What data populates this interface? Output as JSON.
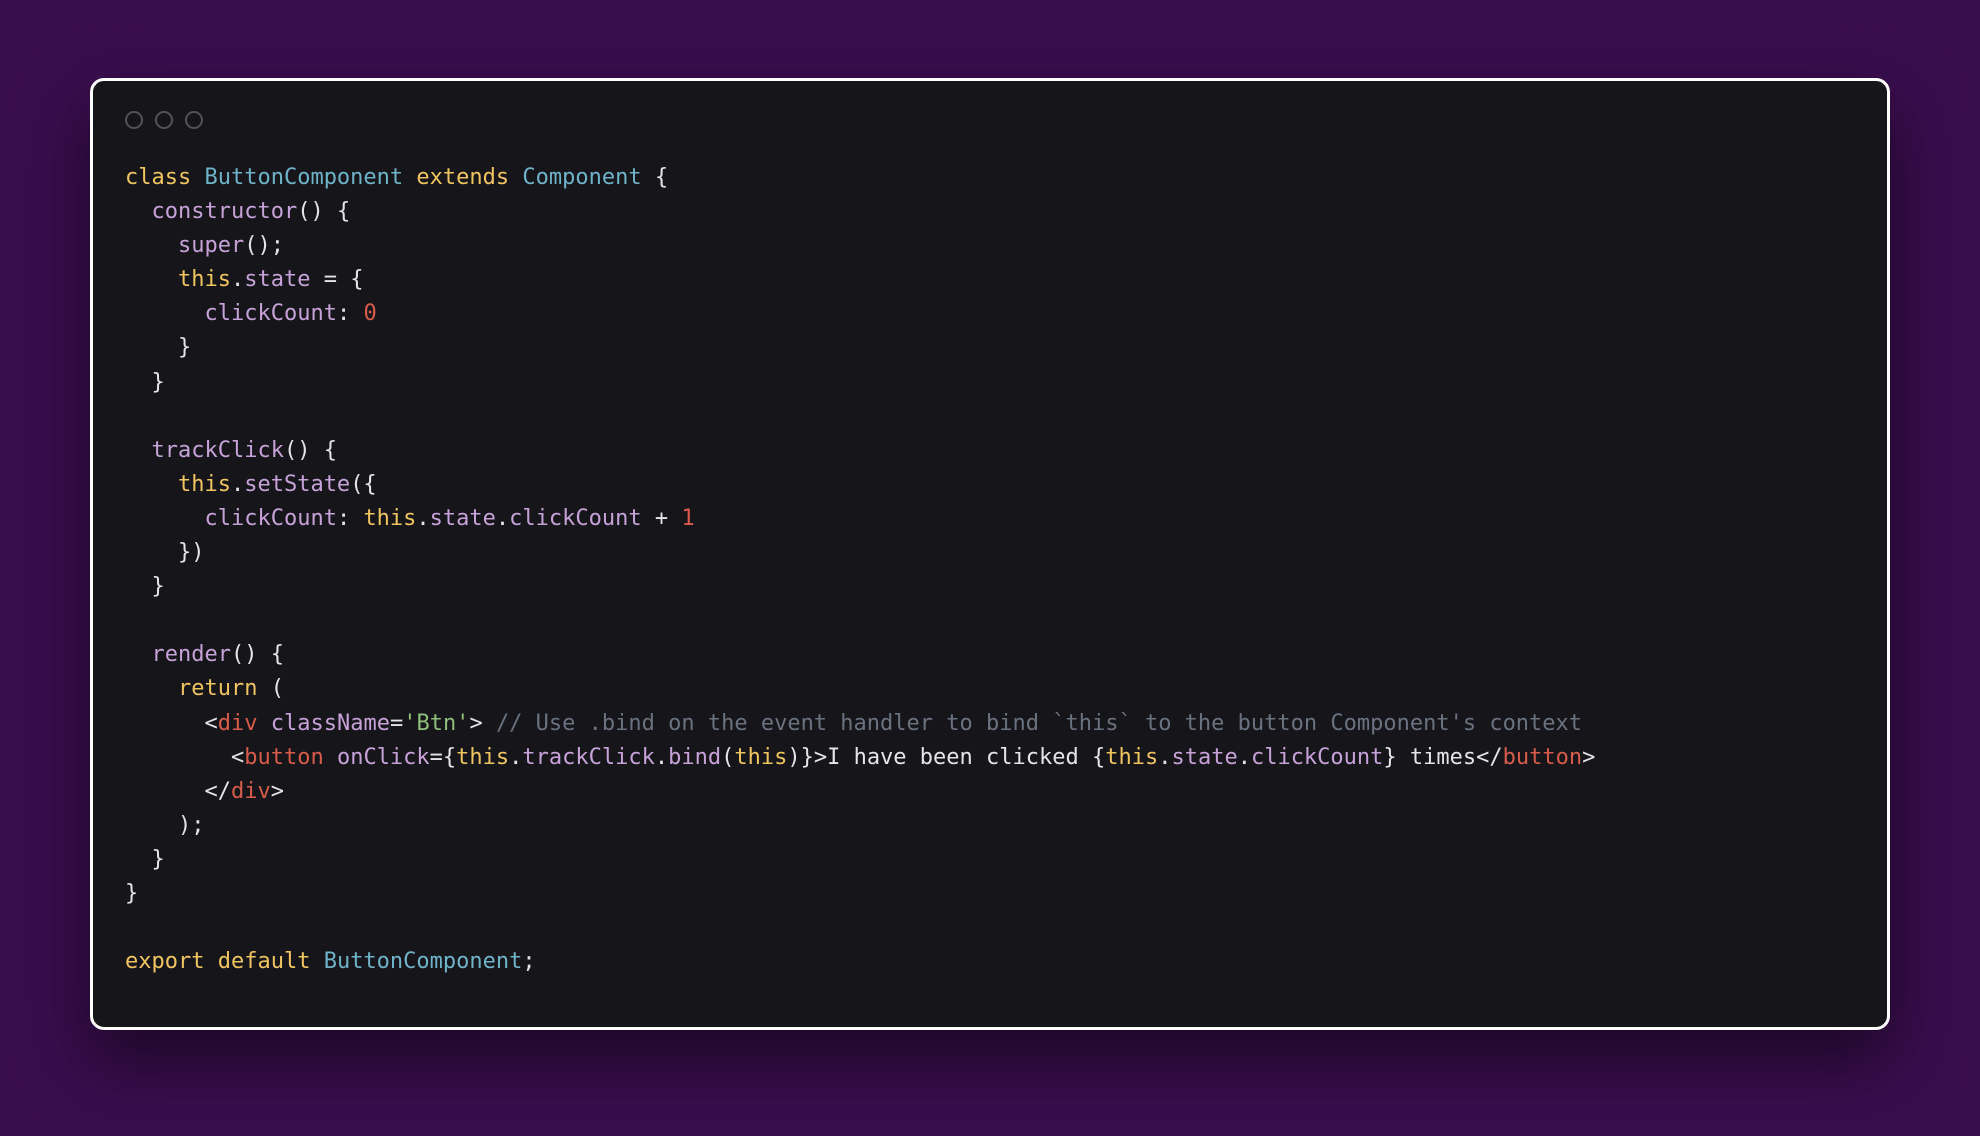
{
  "code": {
    "l1": {
      "kw1": "class",
      "type1": "ButtonComponent",
      "kw2": "extends",
      "type2": "Component",
      "brace": " {"
    },
    "l2": {
      "indent": "  ",
      "fn": "constructor",
      "rest": "() {"
    },
    "l3": {
      "indent": "    ",
      "fn": "super",
      "rest": "();"
    },
    "l4": {
      "indent": "    ",
      "this": "this",
      "dot": ".",
      "prop": "state",
      "rest": " = {"
    },
    "l5": {
      "indent": "      ",
      "prop": "clickCount",
      "colon": ": ",
      "num": "0"
    },
    "l6": {
      "indent": "    ",
      "brace": "}"
    },
    "l7": {
      "indent": "  ",
      "brace": "}"
    },
    "l9": {
      "indent": "  ",
      "fn": "trackClick",
      "rest": "() {"
    },
    "l10": {
      "indent": "    ",
      "this": "this",
      "dot": ".",
      "fn": "setState",
      "rest": "({"
    },
    "l11": {
      "indent": "      ",
      "prop": "clickCount",
      "colon": ": ",
      "this": "this",
      "dot1": ".",
      "state": "state",
      "dot2": ".",
      "cc": "clickCount",
      "plus": " + ",
      "num": "1"
    },
    "l12": {
      "indent": "    ",
      "brace": "})"
    },
    "l13": {
      "indent": "  ",
      "brace": "}"
    },
    "l15": {
      "indent": "  ",
      "fn": "render",
      "rest": "() {"
    },
    "l16": {
      "indent": "    ",
      "kw": "return",
      "rest": " ("
    },
    "l17": {
      "indent": "      ",
      "open": "<",
      "tag": "div",
      "sp": " ",
      "attr": "className",
      "eq": "=",
      "str": "'Btn'",
      "close": ">",
      "sp2": " ",
      "comment": "// Use .bind on the event handler to bind `this` to the button Component's context"
    },
    "l18": {
      "indent": "        ",
      "open": "<",
      "tag": "button",
      "sp": " ",
      "attr": "onClick",
      "eq": "=",
      "b1": "{",
      "this": "this",
      "d1": ".",
      "fn1": "trackClick",
      "d2": ".",
      "fn2": "bind",
      "p1": "(",
      "this2": "this",
      "p2": ")",
      "b2": "}",
      "close": ">",
      "txt1": "I have been clicked ",
      "exb1": "{",
      "this3": "this",
      "d3": ".",
      "st": "state",
      "d4": ".",
      "cc": "clickCount",
      "exb2": "}",
      "txt2": " times",
      "copen": "</",
      "tag2": "button",
      "cclose": ">"
    },
    "l19": {
      "indent": "      ",
      "open": "</",
      "tag": "div",
      "close": ">"
    },
    "l20": {
      "indent": "    ",
      "rest": ");"
    },
    "l21": {
      "indent": "  ",
      "brace": "}"
    },
    "l22": {
      "brace": "}"
    },
    "l24": {
      "kw1": "export",
      "kw2": "default",
      "type": "ButtonComponent",
      "semi": ";"
    }
  }
}
